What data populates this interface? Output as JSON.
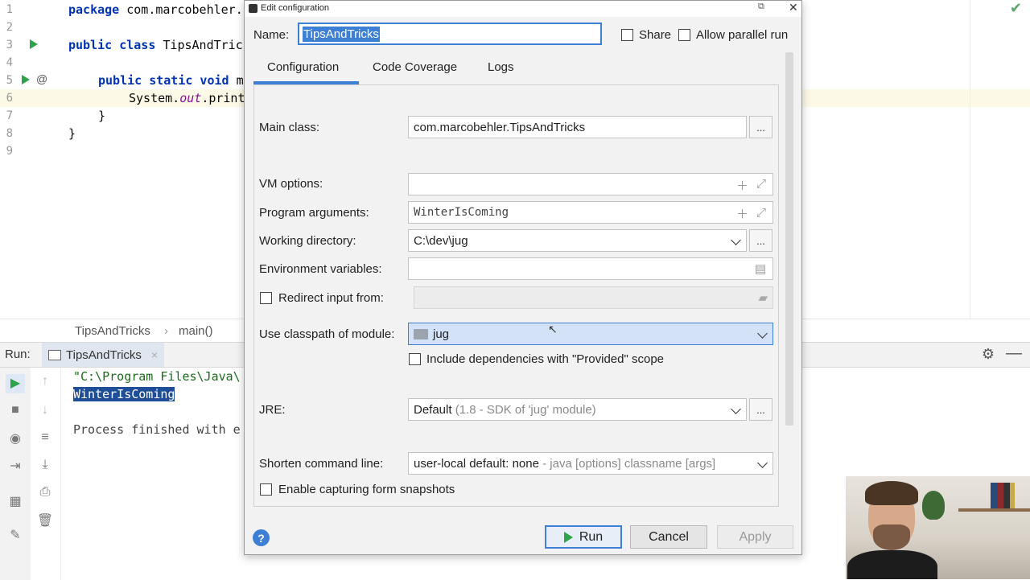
{
  "editor": {
    "line_numbers": [
      "1",
      "2",
      "3",
      "4",
      "5",
      "6",
      "7",
      "8",
      "9"
    ],
    "line1": {
      "kw": "package",
      "rest": " com.marcobehler."
    },
    "line3": {
      "kw": "public class",
      "rest": " TipsAndTric"
    },
    "line5": {
      "kw": "public static void",
      "rest": " m"
    },
    "line6": {
      "pre": "System.",
      "static": "out",
      "post": ".print"
    },
    "line7": "}",
    "line8": "}",
    "at_symbol": "@"
  },
  "breadcrumb": {
    "class": "TipsAndTricks",
    "sep": "›",
    "method": "main()"
  },
  "run": {
    "label": "Run:",
    "tab": "TipsAndTricks",
    "output": [
      "\"C:\\Program Files\\Java\\",
      "WinterIsComing",
      "Process finished with e"
    ]
  },
  "dialog": {
    "title": "Edit configuration",
    "name_label": "Name:",
    "name_value": "TipsAndTricks",
    "share_label": "Share",
    "parallel_label": "Allow parallel run",
    "tabs": [
      "Configuration",
      "Code Coverage",
      "Logs"
    ],
    "main_class": {
      "label": "Main class:",
      "value": "com.marcobehler.TipsAndTricks"
    },
    "vm_options": {
      "label": "VM options:",
      "value": ""
    },
    "program_args": {
      "label": "Program arguments:",
      "value": "WinterIsComing"
    },
    "working_dir": {
      "label": "Working directory:",
      "value": "C:\\dev\\jug"
    },
    "env_vars": {
      "label": "Environment variables:",
      "value": ""
    },
    "redirect": {
      "label": "Redirect input from:"
    },
    "classpath": {
      "label": "Use classpath of module:",
      "value": "jug"
    },
    "include_deps": "Include dependencies with \"Provided\" scope",
    "jre": {
      "label": "JRE:",
      "value": "Default",
      "hint": "(1.8 - SDK of 'jug' module)"
    },
    "shorten": {
      "label": "Shorten command line:",
      "value": "user-local default: none",
      "hint": "- java [options] classname [args]"
    },
    "snapshots": "Enable capturing form snapshots",
    "browse": "...",
    "buttons": {
      "run": "Run",
      "cancel": "Cancel",
      "apply": "Apply"
    },
    "help": "?"
  },
  "colors": {
    "accent": "#3c7fd5",
    "run_green": "#2ea34b"
  }
}
